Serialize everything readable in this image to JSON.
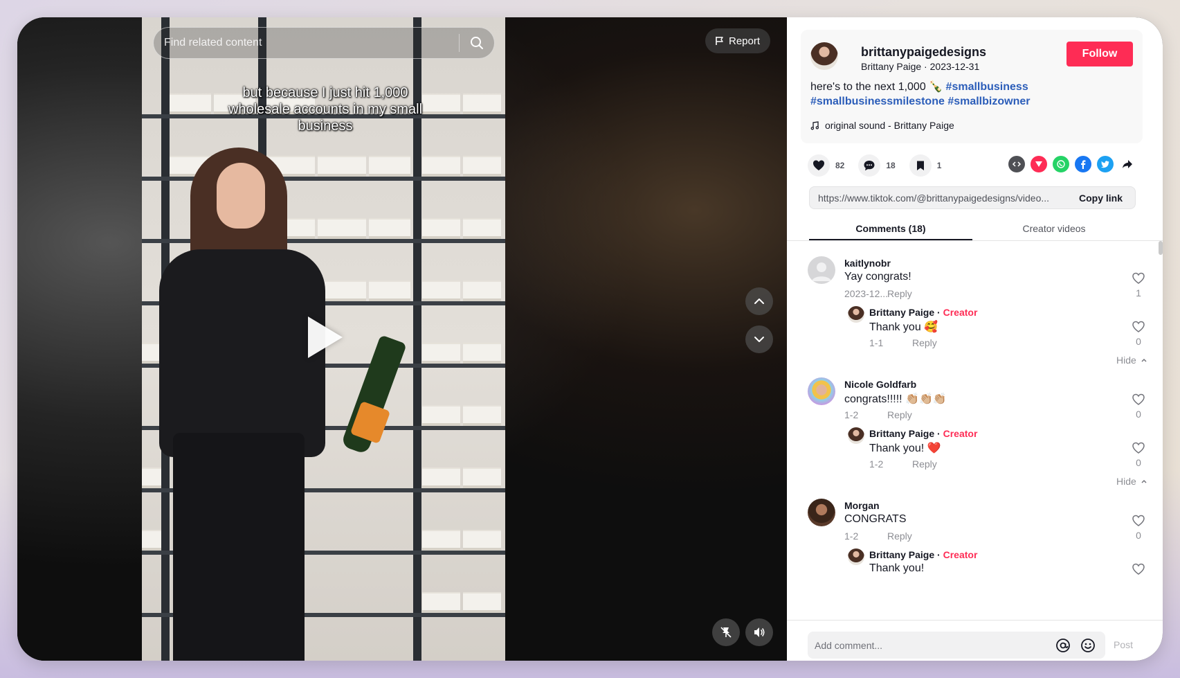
{
  "search": {
    "placeholder": "Find related content"
  },
  "report_label": "Report",
  "video": {
    "caption": "but because I just hit 1,000 wholesale accounts in my small business"
  },
  "post": {
    "username": "brittanypaigedesigns",
    "display_name": "Brittany Paige",
    "date": "2023-12-31",
    "follow_label": "Follow",
    "description_text": "here's to the next 1,000 🍾",
    "hashtags": [
      "#smallbusiness",
      "#smallbusinessmilestone",
      "#smallbizowner"
    ],
    "sound": "original sound - Brittany Paige"
  },
  "stats": {
    "likes": "82",
    "comments": "18",
    "saves": "1"
  },
  "share": {
    "link": "https://www.tiktok.com/@brittanypaigedesigns/video...",
    "copy_label": "Copy link"
  },
  "tabs": {
    "comments": "Comments (18)",
    "creator": "Creator videos"
  },
  "comments": [
    {
      "name": "kaitlynobr",
      "text": "Yay congrats!",
      "date": "2023-12...",
      "reply_label": "Reply",
      "likes": "1",
      "reply": {
        "name": "Brittany Paige",
        "tag": "Creator",
        "text": "Thank you 🥰",
        "date": "1-1",
        "reply_label": "Reply",
        "likes": "0"
      },
      "hide_label": "Hide"
    },
    {
      "name": "Nicole Goldfarb",
      "text": "congrats!!!!! 👏🏼👏🏼👏🏼",
      "date": "1-2",
      "reply_label": "Reply",
      "likes": "0",
      "reply": {
        "name": "Brittany Paige",
        "tag": "Creator",
        "text": "Thank you! ❤️",
        "date": "1-2",
        "reply_label": "Reply",
        "likes": "0"
      },
      "hide_label": "Hide"
    },
    {
      "name": "Morgan",
      "text": "CONGRATS",
      "date": "1-2",
      "reply_label": "Reply",
      "likes": "0",
      "reply": {
        "name": "Brittany Paige",
        "tag": "Creator",
        "text": "Thank you!"
      }
    }
  ],
  "composer": {
    "placeholder": "Add comment...",
    "post_label": "Post"
  },
  "colors": {
    "follow": "#fe2c55",
    "hashtag": "#2b5db9",
    "creator_tag": "#fe2c55"
  }
}
